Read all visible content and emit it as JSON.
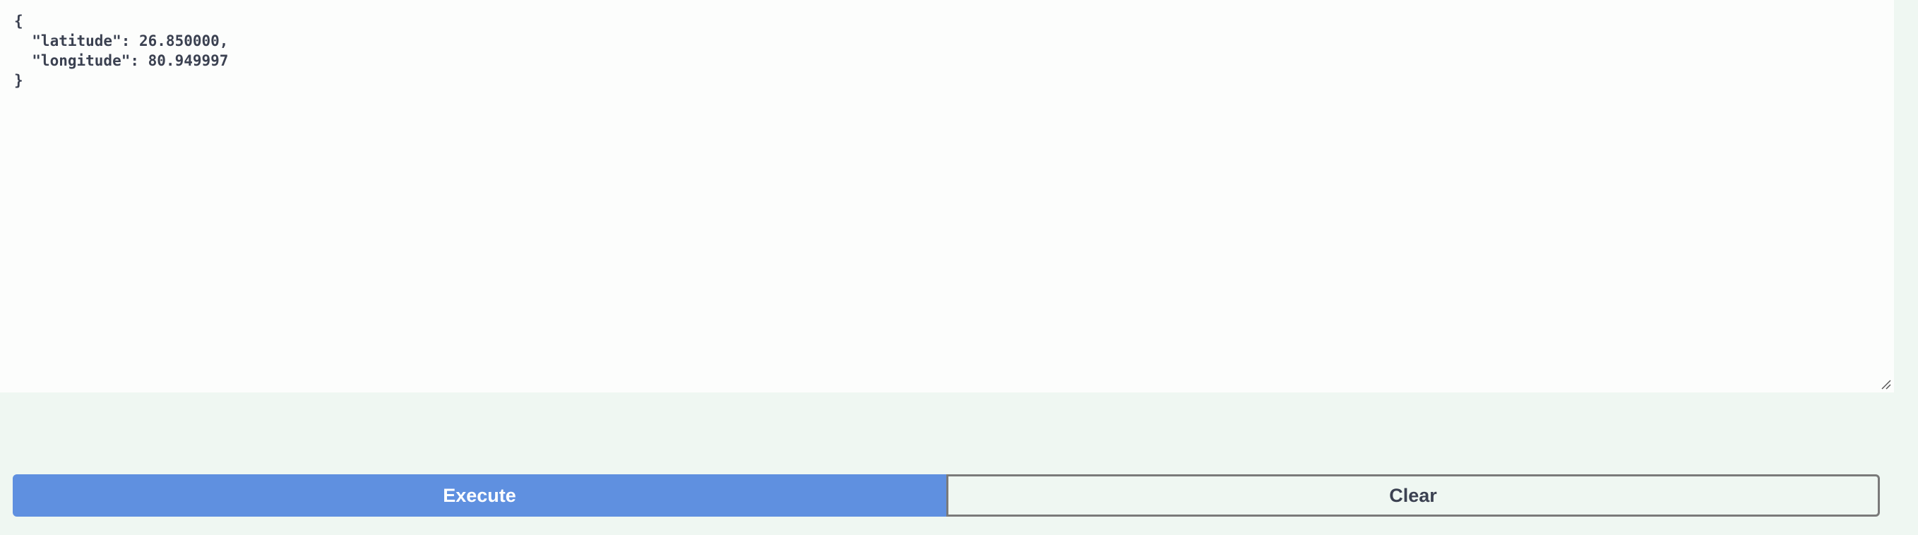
{
  "request_body": {
    "text": "{\n  \"latitude\": 26.850000,\n  \"longitude\": 80.949997\n}"
  },
  "buttons": {
    "execute_label": "Execute",
    "clear_label": "Clear"
  },
  "colors": {
    "execute_bg": "#5f90e0",
    "panel_bg": "#eff7f2",
    "editor_bg": "#fcfdfc",
    "text": "#3b4151"
  },
  "icons": {
    "resize": "resize-handle-icon"
  }
}
